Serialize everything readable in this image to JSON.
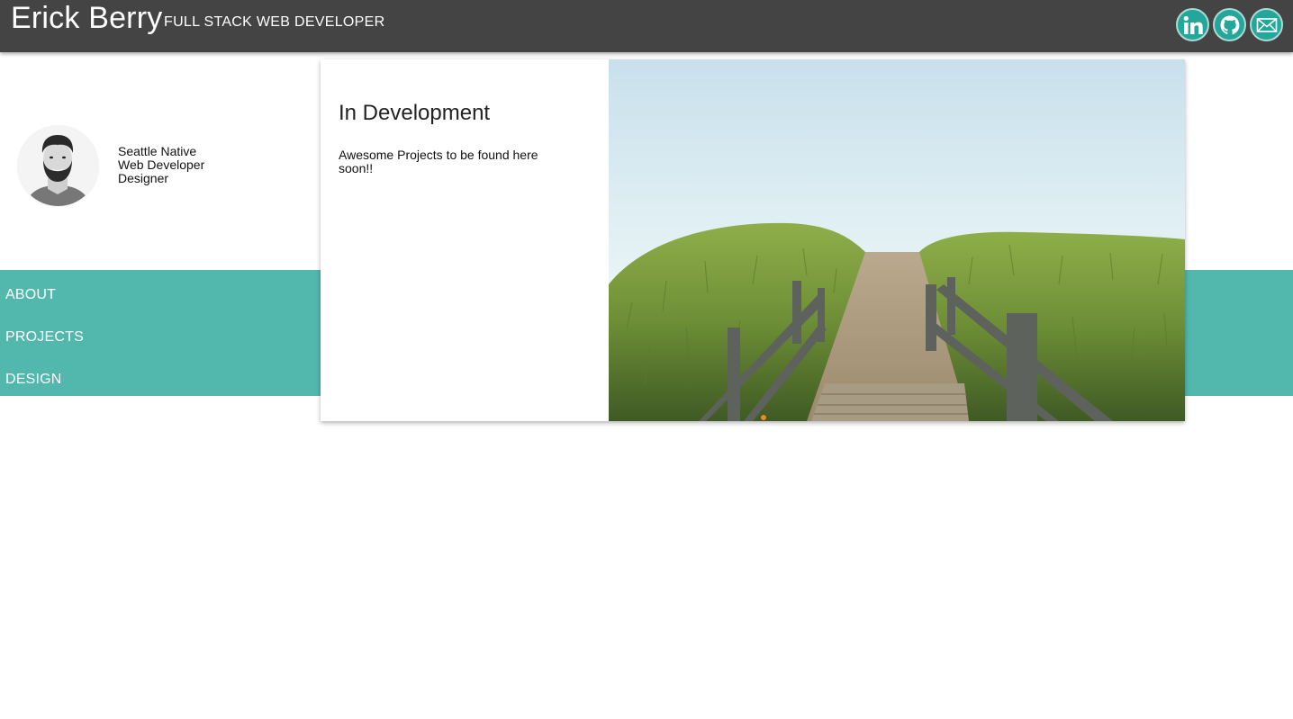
{
  "header": {
    "name": "Erick Berry",
    "tagline": "FULL STACK WEB DEVELOPER",
    "social_icons": [
      "linkedin-icon",
      "github-icon",
      "email-icon"
    ]
  },
  "profile": {
    "bio_lines": [
      "Seattle Native",
      "Web Developer",
      "Designer"
    ]
  },
  "nav": {
    "items": [
      "ABOUT",
      "PROJECTS",
      "DESIGN"
    ]
  },
  "card": {
    "title": "In Development",
    "text": "Awesome Projects to be found here soon!!"
  },
  "colors": {
    "header_bg": "#444444",
    "accent_teal": "#52b7ad",
    "icon_teal": "#24a79a"
  }
}
